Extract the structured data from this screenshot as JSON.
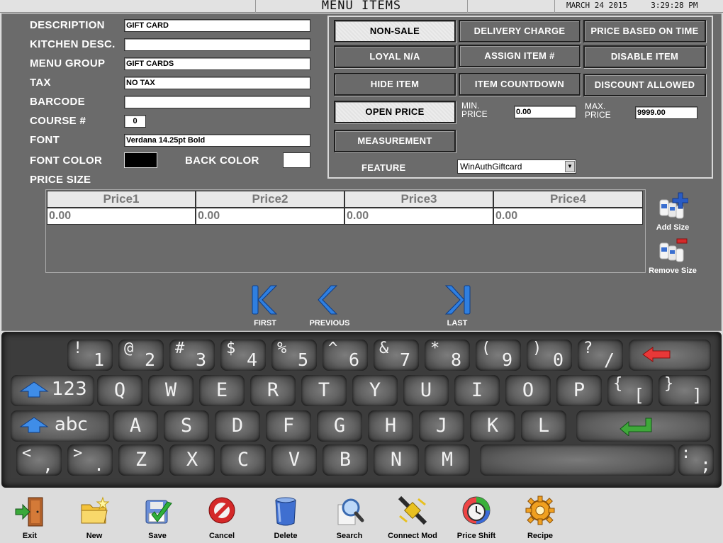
{
  "header": {
    "title": "MENU ITEMS",
    "date": "MARCH 24 2015",
    "time": "3:29:28 PM"
  },
  "form": {
    "description": {
      "label": "DESCRIPTION",
      "value": "GIFT CARD"
    },
    "kitchen_desc": {
      "label": "KITCHEN DESC.",
      "value": ""
    },
    "menu_group": {
      "label": "MENU GROUP",
      "value": "GIFT CARDS"
    },
    "tax": {
      "label": "TAX",
      "value": "NO TAX"
    },
    "barcode": {
      "label": "BARCODE",
      "value": ""
    },
    "course": {
      "label": "COURSE #",
      "value": "0"
    },
    "font": {
      "label": "FONT",
      "value": "Verdana 14.25pt Bold"
    },
    "font_color": {
      "label": "FONT COLOR",
      "color": "#000000"
    },
    "back_color": {
      "label": "BACK COLOR",
      "color": "#ffffff"
    },
    "price_size_label": "PRICE  SIZE"
  },
  "buttons": {
    "non_sale": "NON-SALE",
    "delivery_charge": "DELIVERY CHARGE",
    "price_based_on_time": "PRICE BASED ON TIME",
    "loyal_na": "LOYAL N/A",
    "assign_item": "ASSIGN ITEM #",
    "disable_item": "DISABLE ITEM",
    "hide_item": "HIDE ITEM",
    "item_countdown": "ITEM COUNTDOWN",
    "discount_allowed": "DISCOUNT ALLOWED",
    "open_price": "OPEN PRICE",
    "measurement": "MEASUREMENT"
  },
  "price_limits": {
    "min_label_1": "MIN.",
    "min_label_2": "PRICE",
    "min_value": "0.00",
    "max_label_1": "MAX.",
    "max_label_2": "PRICE",
    "max_value": "9999.00"
  },
  "feature": {
    "label": "FEATURE",
    "value": "WinAuthGiftcard"
  },
  "price_table": {
    "headers": [
      "Price1",
      "Price2",
      "Price3",
      "Price4"
    ],
    "values": [
      "0.00",
      "0.00",
      "0.00",
      "0.00"
    ]
  },
  "size_tools": {
    "add": "Add Size",
    "remove": "Remove Size"
  },
  "nav": {
    "first": "FIRST",
    "previous": "PREVIOUS",
    "last": "LAST"
  },
  "keyboard": {
    "row1": [
      {
        "shift": "!",
        "base": "1"
      },
      {
        "shift": "@",
        "base": "2"
      },
      {
        "shift": "#",
        "base": "3"
      },
      {
        "shift": "$",
        "base": "4"
      },
      {
        "shift": "%",
        "base": "5"
      },
      {
        "shift": "^",
        "base": "6"
      },
      {
        "shift": "&",
        "base": "7"
      },
      {
        "shift": "*",
        "base": "8"
      },
      {
        "shift": "(",
        "base": "9"
      },
      {
        "shift": ")",
        "base": "0"
      },
      {
        "shift": "?",
        "base": "/"
      }
    ],
    "row2_mode": "123",
    "row2": [
      "Q",
      "W",
      "E",
      "R",
      "T",
      "Y",
      "U",
      "I",
      "O",
      "P"
    ],
    "row2_extra": [
      {
        "shift": "{",
        "base": "["
      },
      {
        "shift": "}",
        "base": "]"
      }
    ],
    "row3_mode": "abc",
    "row3": [
      "A",
      "S",
      "D",
      "F",
      "G",
      "H",
      "J",
      "K",
      "L"
    ],
    "row4_extra": [
      {
        "shift": "<",
        "base": ","
      },
      {
        "shift": ">",
        "base": "."
      }
    ],
    "row4": [
      "Z",
      "X",
      "C",
      "V",
      "B",
      "N",
      "M"
    ],
    "row4_end": {
      "shift": ":",
      "base": ";"
    }
  },
  "toolbar": {
    "exit": "Exit",
    "new": "New",
    "save": "Save",
    "cancel": "Cancel",
    "delete": "Delete",
    "search": "Search",
    "connect_mod": "Connect Mod",
    "price_shift": "Price Shift",
    "recipe": "Recipe"
  },
  "colors": {
    "panel": "#6b6b6b",
    "keyboard": "#3c3c3c",
    "active_button": "#ececec",
    "nav_blue": "#2f7fe0"
  }
}
